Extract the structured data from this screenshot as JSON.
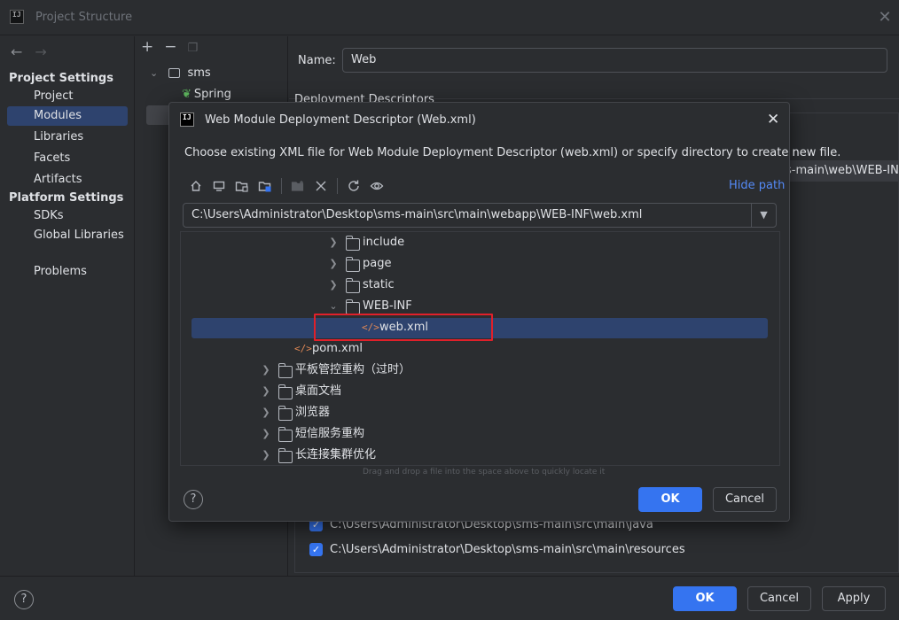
{
  "window": {
    "title": "Project Structure",
    "logo_text": "IJ"
  },
  "left_nav": {
    "back_icon": "arrow-left-icon",
    "forward_icon": "arrow-right-icon",
    "project_settings_header": "Project Settings",
    "platform_settings_header": "Platform Settings",
    "project_items": [
      "Project",
      "Modules",
      "Libraries",
      "Facets",
      "Artifacts"
    ],
    "platform_items": [
      "SDKs",
      "Global Libraries"
    ],
    "problems": "Problems",
    "selected": "Modules"
  },
  "module_tree": {
    "add_icon": "+",
    "remove_icon": "−",
    "root": "sms",
    "child": "Spring"
  },
  "module_detail": {
    "name_label": "Name:",
    "name_value": "Web",
    "deployment_descriptors_label": "Deployment Descriptors",
    "peek_path": "s-main\\web\\WEB-INF",
    "source_roots": [
      "C:\\Users\\Administrator\\Desktop\\sms-main\\src\\main\\java",
      "C:\\Users\\Administrator\\Desktop\\sms-main\\src\\main\\resources"
    ]
  },
  "footer": {
    "help": "?",
    "ok": "OK",
    "cancel": "Cancel",
    "apply": "Apply"
  },
  "dialog": {
    "title": "Web Module Deployment Descriptor (Web.xml)",
    "description": "Choose existing XML file for Web Module Deployment Descriptor (web.xml) or specify directory to create new file.",
    "hide_path": "Hide path",
    "path_value": "C:\\Users\\Administrator\\Desktop\\sms-main\\src\\main\\webapp\\WEB-INF\\web.xml",
    "toolbar_icons": [
      "home-icon",
      "desktop-icon",
      "project-folder-icon",
      "module-folder-icon",
      "new-folder-icon",
      "delete-icon",
      "refresh-icon",
      "show-hidden-icon"
    ],
    "tree": [
      {
        "label": "include",
        "kind": "folder",
        "expanded": false
      },
      {
        "label": "page",
        "kind": "folder",
        "expanded": false
      },
      {
        "label": "static",
        "kind": "folder",
        "expanded": false
      },
      {
        "label": "WEB-INF",
        "kind": "folder",
        "expanded": true
      },
      {
        "label": "web.xml",
        "kind": "xml",
        "selected": true
      },
      {
        "label": "pom.xml",
        "kind": "xml"
      },
      {
        "label": "平板管控重构（过时）",
        "kind": "folder",
        "expanded": false
      },
      {
        "label": "桌面文档",
        "kind": "folder",
        "expanded": false
      },
      {
        "label": "浏览器",
        "kind": "folder",
        "expanded": false
      },
      {
        "label": "短信服务重构",
        "kind": "folder",
        "expanded": false
      },
      {
        "label": "长连接集群优化",
        "kind": "folder",
        "expanded": false
      }
    ],
    "drag_hint": "Drag and drop a file into the space above to quickly locate it",
    "help": "?",
    "ok": "OK",
    "cancel": "Cancel"
  },
  "colors": {
    "background": "#2b2d30",
    "selection": "#2e436e",
    "accent": "#3574f0",
    "link": "#548af7",
    "highlight_box": "#e0202a",
    "xml_icon": "#e08855"
  }
}
